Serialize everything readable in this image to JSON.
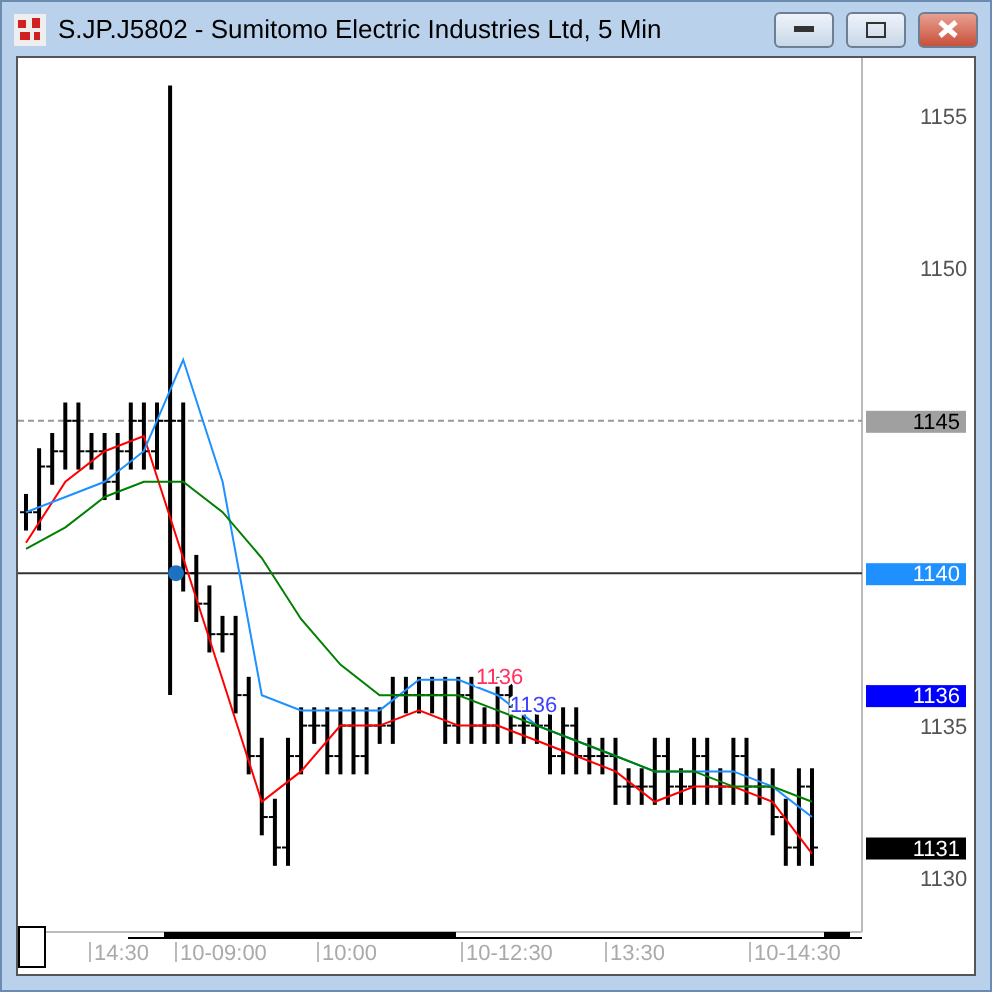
{
  "window": {
    "title": "S.JP.J5802 - Sumitomo Electric Industries Ltd, 5 Min"
  },
  "price_tags": [
    {
      "label": "1145",
      "color": "#a0a0a0"
    },
    {
      "label": "1140",
      "color": "#1e90ff"
    },
    {
      "label": "1136",
      "color": "#0000ff"
    },
    {
      "label": "1131",
      "color": "#000000"
    }
  ],
  "line_labels": [
    {
      "label": "1136",
      "color": "#ff3060"
    },
    {
      "label": "1136",
      "color": "#4040ff"
    }
  ],
  "time_axis": [
    "14:30",
    "10-09:00",
    "10:00",
    "10-12:30",
    "13:30",
    "10-14:30"
  ],
  "chart_data": {
    "type": "line",
    "ylim": [
      1130,
      1155
    ],
    "yticks": [
      {
        "value": 1155,
        "label": "1155"
      },
      {
        "value": 1150,
        "label": "1150"
      },
      {
        "value": 1135,
        "label": "1135"
      },
      {
        "value": 1130,
        "label": "1130"
      }
    ],
    "series": [
      {
        "color": "#ff0000",
        "values": [
          1141,
          1143,
          1144,
          1144.5,
          1140.5,
          1136.5,
          1132.5,
          1133.5,
          1135,
          1135,
          1135.5,
          1135,
          1135,
          1134.5,
          1134,
          1133.5,
          1132.5,
          1133,
          1133,
          1132.5,
          1130.8
        ]
      },
      {
        "color": "#1e90ff",
        "values": [
          1142,
          1142.5,
          1143,
          1144,
          1147,
          1143,
          1136,
          1135.5,
          1135.5,
          1135.5,
          1136.5,
          1136.5,
          1136,
          1135,
          1134.5,
          1134,
          1133.5,
          1133.5,
          1133.5,
          1133,
          1132
        ]
      },
      {
        "color": "#008000",
        "values": [
          1140.8,
          1141.5,
          1142.5,
          1143,
          1143,
          1142,
          1140.5,
          1138.5,
          1137,
          1136,
          1136,
          1136,
          1135.5,
          1135,
          1134.5,
          1134,
          1133.5,
          1133.5,
          1133,
          1133,
          1132.5
        ]
      }
    ]
  }
}
